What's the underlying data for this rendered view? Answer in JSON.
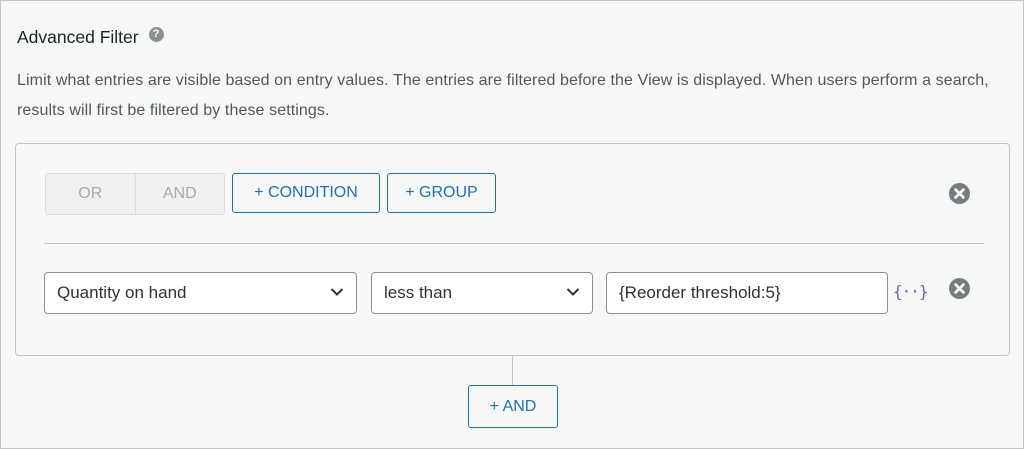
{
  "header": {
    "title": "Advanced Filter",
    "help_icon": "question-circle-icon",
    "description": "Limit what entries are visible based on entry values. The entries are filtered before the View is displayed. When users perform a search, results will first be filtered by these settings."
  },
  "group": {
    "logic_options": [
      "OR",
      "AND"
    ],
    "add_condition_label": "+ CONDITION",
    "add_group_label": "+ GROUP",
    "remove_icon": "close-circle-icon"
  },
  "condition": {
    "field_value": "Quantity on hand",
    "operator_value": "less than",
    "value": "{Reorder threshold:5}",
    "merge_tag_icon": "{··}",
    "remove_icon": "close-circle-icon"
  },
  "footer": {
    "add_and_label": "+ AND"
  },
  "colors": {
    "accent": "#2271b1",
    "merge_tag": "#6f5fb5",
    "remove_icon": "#787c82"
  }
}
